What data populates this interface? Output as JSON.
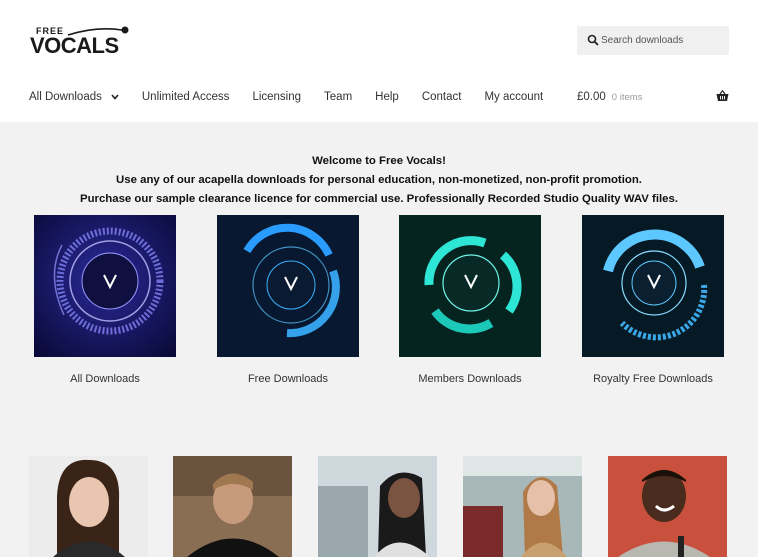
{
  "brand": {
    "logo_top": "FREE",
    "logo_main": "VOCALS"
  },
  "search": {
    "placeholder": "Search downloads"
  },
  "nav": {
    "items": [
      {
        "label": "All Downloads",
        "has_dropdown": true
      },
      {
        "label": "Unlimited Access"
      },
      {
        "label": "Licensing"
      },
      {
        "label": "Team"
      },
      {
        "label": "Help"
      },
      {
        "label": "Contact"
      },
      {
        "label": "My account"
      }
    ]
  },
  "cart": {
    "price": "£0.00",
    "items": "0 items"
  },
  "intro": {
    "line1": "Welcome to Free Vocals!",
    "line2": "Use any of our acapella downloads for personal education, non-monetized, non-profit promotion.",
    "line3": "Purchase our sample clearance licence for commercial use. Professionally Recorded Studio Quality WAV files."
  },
  "categories": [
    {
      "label": "All Downloads",
      "color": "#3a3ad0"
    },
    {
      "label": "Free Downloads",
      "color": "#3aa0ff"
    },
    {
      "label": "Members Downloads",
      "color": "#2ee6d6"
    },
    {
      "label": "Royalty Free Downloads",
      "color": "#5cc8ff"
    }
  ],
  "singers": [
    {
      "name": "singer-1"
    },
    {
      "name": "singer-2"
    },
    {
      "name": "singer-3"
    },
    {
      "name": "singer-4"
    },
    {
      "name": "singer-5"
    }
  ]
}
